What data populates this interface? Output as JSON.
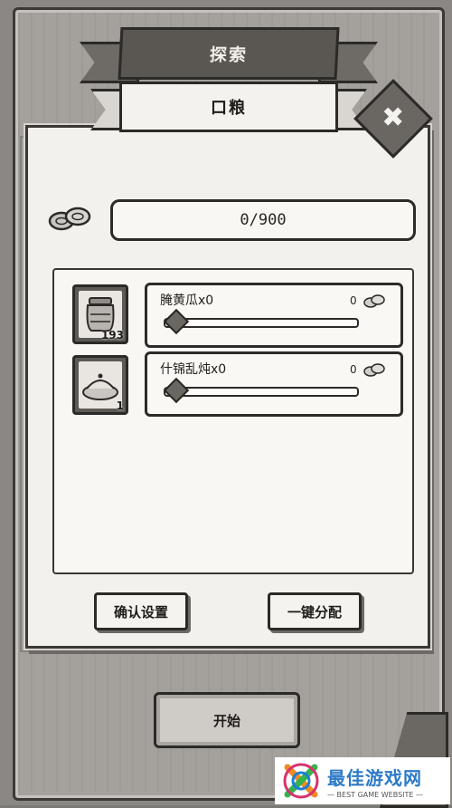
{
  "header": {
    "title": "探索",
    "subtitle": "口粮",
    "close_symbol": "✖"
  },
  "ration": {
    "value": "0/900",
    "icon": "coin-icon"
  },
  "items": [
    {
      "name": "腌黄瓜x0",
      "stock": "193",
      "quantity": "0",
      "slider_fraction": 0,
      "icon": "pickled-cucumber-jar-icon"
    },
    {
      "name": "什锦乱炖x0",
      "stock": "1",
      "quantity": "0",
      "slider_fraction": 0,
      "icon": "stew-dish-icon"
    }
  ],
  "buttons": {
    "confirm": "确认设置",
    "auto_assign": "一键分配",
    "start": "开始"
  },
  "watermark": {
    "title": "最佳游戏网",
    "subtitle": "— BEST GAME WEBSITE —"
  },
  "colors": {
    "panel": "#f3f1ed",
    "frame": "#a4a19d",
    "ink": "#2c2a27",
    "watermark_blue": "#2d7ac7"
  }
}
